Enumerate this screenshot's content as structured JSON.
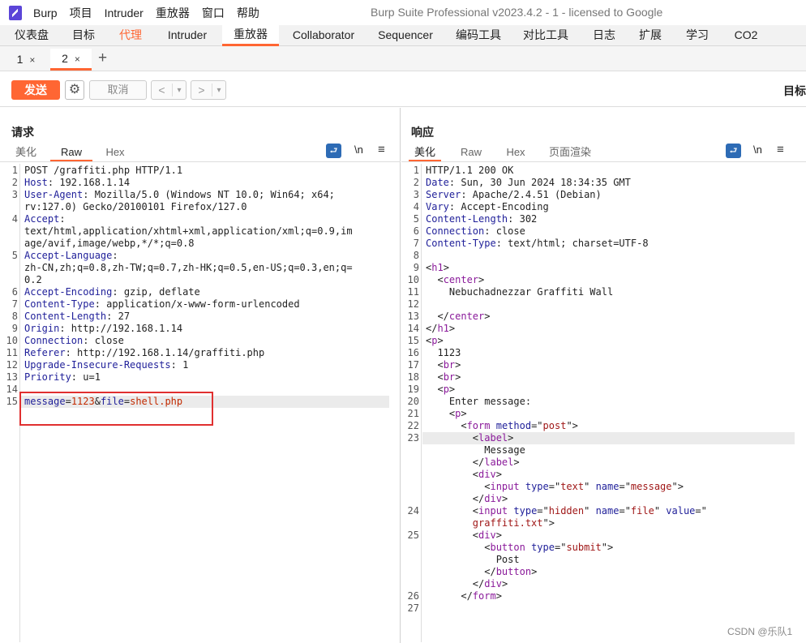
{
  "menubar": {
    "items": [
      "Burp",
      "项目",
      "Intruder",
      "重放器",
      "窗口",
      "帮助"
    ],
    "window_title": "Burp Suite Professional v2023.4.2 - 1 - licensed to Google"
  },
  "main_tabs": [
    "仪表盘",
    "目标",
    "代理",
    "Intruder",
    "重放器",
    "Collaborator",
    "Sequencer",
    "编码工具",
    "对比工具",
    "日志",
    "扩展",
    "学习",
    "CO2"
  ],
  "active_main_tab": "重放器",
  "repeater_tabs": [
    {
      "label": "1",
      "close": "×"
    },
    {
      "label": "2",
      "close": "×"
    }
  ],
  "new_tab_label": "+",
  "toolbar": {
    "send_label": "发送",
    "cancel_label": "取消",
    "back_label": "<",
    "forward_label": ">",
    "dropdown": "▾",
    "target_label": "目标"
  },
  "request": {
    "title": "请求",
    "view_tabs": [
      "美化",
      "Raw",
      "Hex"
    ],
    "active_view": "Raw",
    "newline_label": "\\n",
    "lines": [
      {
        "n": "1",
        "segs": [
          [
            "v",
            "POST /graffiti.php HTTP/1.1"
          ]
        ]
      },
      {
        "n": "2",
        "segs": [
          [
            "k",
            "Host"
          ],
          [
            "v",
            ": 192.168.1.14"
          ]
        ]
      },
      {
        "n": "3",
        "segs": [
          [
            "k",
            "User-Agent"
          ],
          [
            "v",
            ": Mozilla/5.0 (Windows NT 10.0; Win64; x64;"
          ]
        ]
      },
      {
        "n": "",
        "segs": [
          [
            "v",
            "rv:127.0) Gecko/20100101 Firefox/127.0"
          ]
        ]
      },
      {
        "n": "4",
        "segs": [
          [
            "k",
            "Accept"
          ],
          [
            "v",
            ":"
          ]
        ]
      },
      {
        "n": "",
        "segs": [
          [
            "v",
            "text/html,application/xhtml+xml,application/xml;q=0.9,im"
          ]
        ]
      },
      {
        "n": "",
        "segs": [
          [
            "v",
            "age/avif,image/webp,*/*;q=0.8"
          ]
        ]
      },
      {
        "n": "5",
        "segs": [
          [
            "k",
            "Accept-Language"
          ],
          [
            "v",
            ":"
          ]
        ]
      },
      {
        "n": "",
        "segs": [
          [
            "v",
            "zh-CN,zh;q=0.8,zh-TW;q=0.7,zh-HK;q=0.5,en-US;q=0.3,en;q="
          ]
        ]
      },
      {
        "n": "",
        "segs": [
          [
            "v",
            "0.2"
          ]
        ]
      },
      {
        "n": "6",
        "segs": [
          [
            "k",
            "Accept-Encoding"
          ],
          [
            "v",
            ": gzip, deflate"
          ]
        ]
      },
      {
        "n": "7",
        "segs": [
          [
            "k",
            "Content-Type"
          ],
          [
            "v",
            ": application/x-www-form-urlencoded"
          ]
        ]
      },
      {
        "n": "8",
        "segs": [
          [
            "k",
            "Content-Length"
          ],
          [
            "v",
            ": 27"
          ]
        ]
      },
      {
        "n": "9",
        "segs": [
          [
            "k",
            "Origin"
          ],
          [
            "v",
            ": http://192.168.1.14"
          ]
        ]
      },
      {
        "n": "10",
        "segs": [
          [
            "k",
            "Connection"
          ],
          [
            "v",
            ": close"
          ]
        ]
      },
      {
        "n": "11",
        "segs": [
          [
            "k",
            "Referer"
          ],
          [
            "v",
            ": http://192.168.1.14/graffiti.php"
          ]
        ]
      },
      {
        "n": "12",
        "segs": [
          [
            "k",
            "Upgrade-Insecure-Requests"
          ],
          [
            "v",
            ": 1"
          ]
        ]
      },
      {
        "n": "13",
        "segs": [
          [
            "k",
            "Priority"
          ],
          [
            "v",
            ": u=1"
          ]
        ]
      },
      {
        "n": "14",
        "segs": []
      },
      {
        "n": "15",
        "segs": [
          [
            "pk",
            "message"
          ],
          [
            "v",
            "="
          ],
          [
            "pv",
            "1123"
          ],
          [
            "v",
            "&"
          ],
          [
            "pk",
            "file"
          ],
          [
            "v",
            "="
          ],
          [
            "pv",
            "shell.php"
          ]
        ]
      }
    ]
  },
  "response": {
    "title": "响应",
    "view_tabs": [
      "美化",
      "Raw",
      "Hex",
      "页面渲染"
    ],
    "active_view": "美化",
    "newline_label": "\\n",
    "lines": [
      {
        "n": "1",
        "segs": [
          [
            "v",
            "HTTP/1.1 200 OK"
          ]
        ]
      },
      {
        "n": "2",
        "segs": [
          [
            "k",
            "Date"
          ],
          [
            "v",
            ": Sun, 30 Jun 2024 18:34:35 GMT"
          ]
        ]
      },
      {
        "n": "3",
        "segs": [
          [
            "k",
            "Server"
          ],
          [
            "v",
            ": Apache/2.4.51 (Debian)"
          ]
        ]
      },
      {
        "n": "4",
        "segs": [
          [
            "k",
            "Vary"
          ],
          [
            "v",
            ": Accept-Encoding"
          ]
        ]
      },
      {
        "n": "5",
        "segs": [
          [
            "k",
            "Content-Length"
          ],
          [
            "v",
            ": 302"
          ]
        ]
      },
      {
        "n": "6",
        "segs": [
          [
            "k",
            "Connection"
          ],
          [
            "v",
            ": close"
          ]
        ]
      },
      {
        "n": "7",
        "segs": [
          [
            "k",
            "Content-Type"
          ],
          [
            "v",
            ": text/html; charset=UTF-8"
          ]
        ]
      },
      {
        "n": "8",
        "segs": []
      },
      {
        "n": "9",
        "segs": [
          [
            "v",
            "<"
          ],
          [
            "tag",
            "h1"
          ],
          [
            "v",
            ">"
          ]
        ]
      },
      {
        "n": "10",
        "segs": [
          [
            "v",
            "  <"
          ],
          [
            "tag",
            "center"
          ],
          [
            "v",
            ">"
          ]
        ]
      },
      {
        "n": "11",
        "segs": [
          [
            "v",
            "    Nebuchadnezzar Graffiti Wall"
          ]
        ]
      },
      {
        "n": "12",
        "segs": []
      },
      {
        "n": "13",
        "segs": [
          [
            "v",
            "  </"
          ],
          [
            "tag",
            "center"
          ],
          [
            "v",
            ">"
          ]
        ]
      },
      {
        "n": "14",
        "segs": [
          [
            "v",
            "</"
          ],
          [
            "tag",
            "h1"
          ],
          [
            "v",
            ">"
          ]
        ]
      },
      {
        "n": "15",
        "segs": [
          [
            "v",
            "<"
          ],
          [
            "tag",
            "p"
          ],
          [
            "v",
            ">"
          ]
        ]
      },
      {
        "n": "16",
        "segs": [
          [
            "v",
            "  1123"
          ]
        ]
      },
      {
        "n": "17",
        "segs": [
          [
            "v",
            "  <"
          ],
          [
            "tag",
            "br"
          ],
          [
            "v",
            ">"
          ]
        ]
      },
      {
        "n": "18",
        "segs": [
          [
            "v",
            "  <"
          ],
          [
            "tag",
            "br"
          ],
          [
            "v",
            ">"
          ]
        ]
      },
      {
        "n": "19",
        "segs": [
          [
            "v",
            "  <"
          ],
          [
            "tag",
            "p"
          ],
          [
            "v",
            ">"
          ]
        ]
      },
      {
        "n": "20",
        "segs": [
          [
            "v",
            "    Enter message:"
          ]
        ]
      },
      {
        "n": "21",
        "segs": [
          [
            "v",
            "    <"
          ],
          [
            "tag",
            "p"
          ],
          [
            "v",
            ">"
          ]
        ]
      },
      {
        "n": "22",
        "segs": [
          [
            "v",
            "      <"
          ],
          [
            "tag",
            "form"
          ],
          [
            "v",
            " "
          ],
          [
            "attr",
            "method"
          ],
          [
            "v",
            "=\""
          ],
          [
            "str",
            "post"
          ],
          [
            "v",
            "\">"
          ]
        ]
      },
      {
        "n": "23",
        "segs": [
          [
            "v",
            "        <"
          ],
          [
            "tag",
            "label"
          ],
          [
            "v",
            ">"
          ]
        ]
      },
      {
        "n": "",
        "segs": [
          [
            "v",
            "          Message"
          ]
        ]
      },
      {
        "n": "",
        "segs": [
          [
            "v",
            "        </"
          ],
          [
            "tag",
            "label"
          ],
          [
            "v",
            ">"
          ]
        ]
      },
      {
        "n": "",
        "segs": [
          [
            "v",
            "        <"
          ],
          [
            "tag",
            "div"
          ],
          [
            "v",
            ">"
          ]
        ]
      },
      {
        "n": "",
        "segs": [
          [
            "v",
            "          <"
          ],
          [
            "tag",
            "input"
          ],
          [
            "v",
            " "
          ],
          [
            "attr",
            "type"
          ],
          [
            "v",
            "=\""
          ],
          [
            "str",
            "text"
          ],
          [
            "v",
            "\" "
          ],
          [
            "attr",
            "name"
          ],
          [
            "v",
            "=\""
          ],
          [
            "str",
            "message"
          ],
          [
            "v",
            "\">"
          ]
        ]
      },
      {
        "n": "",
        "segs": [
          [
            "v",
            "        </"
          ],
          [
            "tag",
            "div"
          ],
          [
            "v",
            ">"
          ]
        ]
      },
      {
        "n": "24",
        "segs": [
          [
            "v",
            "        <"
          ],
          [
            "tag",
            "input"
          ],
          [
            "v",
            " "
          ],
          [
            "attr",
            "type"
          ],
          [
            "v",
            "=\""
          ],
          [
            "str",
            "hidden"
          ],
          [
            "v",
            "\" "
          ],
          [
            "attr",
            "name"
          ],
          [
            "v",
            "=\""
          ],
          [
            "str",
            "file"
          ],
          [
            "v",
            "\" "
          ],
          [
            "attr",
            "value"
          ],
          [
            "v",
            "=\""
          ]
        ]
      },
      {
        "n": "",
        "segs": [
          [
            "str",
            "        graffiti.txt"
          ],
          [
            "v",
            "\">"
          ]
        ]
      },
      {
        "n": "25",
        "segs": [
          [
            "v",
            "        <"
          ],
          [
            "tag",
            "div"
          ],
          [
            "v",
            ">"
          ]
        ]
      },
      {
        "n": "",
        "segs": [
          [
            "v",
            "          <"
          ],
          [
            "tag",
            "button"
          ],
          [
            "v",
            " "
          ],
          [
            "attr",
            "type"
          ],
          [
            "v",
            "=\""
          ],
          [
            "str",
            "submit"
          ],
          [
            "v",
            "\">"
          ]
        ]
      },
      {
        "n": "",
        "segs": [
          [
            "v",
            "            Post"
          ]
        ]
      },
      {
        "n": "",
        "segs": [
          [
            "v",
            "          </"
          ],
          [
            "tag",
            "button"
          ],
          [
            "v",
            ">"
          ]
        ]
      },
      {
        "n": "",
        "segs": [
          [
            "v",
            "        </"
          ],
          [
            "tag",
            "div"
          ],
          [
            "v",
            ">"
          ]
        ]
      },
      {
        "n": "26",
        "segs": [
          [
            "v",
            "      </"
          ],
          [
            "tag",
            "form"
          ],
          [
            "v",
            ">"
          ]
        ]
      },
      {
        "n": "27",
        "segs": []
      }
    ]
  },
  "watermark": "CSDN @乐队1",
  "colors": {
    "accent": "#ff6633",
    "highlight_box": "#e03030",
    "blue_icon": "#2d6bb5"
  }
}
